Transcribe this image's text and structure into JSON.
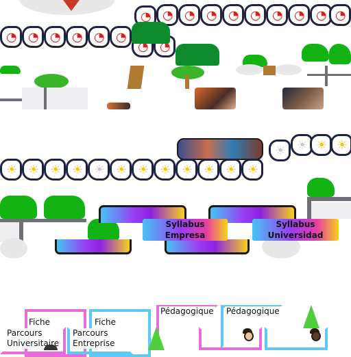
{
  "colors": {
    "red_mark": "#e21b1b",
    "bulb_on": "#f2c318",
    "bulb_off": "#c9c9c9",
    "grass": "#12b312",
    "pink_bracket": "#e86bdc",
    "blue_bracket": "#5fc9f3"
  },
  "icons": {
    "head_red": "head-target-icon",
    "head_bulb": "head-lightbulb-icon",
    "tree": "tree-icon",
    "bush": "bush-icon",
    "avatar": "player-avatar-icon"
  },
  "panels": {
    "syllabus_empresa": {
      "line1": "Syllabus",
      "line2": "Empresa"
    },
    "syllabus_universidad": {
      "line1": "Syllabus",
      "line2": "Universidad"
    }
  },
  "brackets": {
    "fiche_1": "Fiche",
    "fiche_2": "Fiche",
    "parcours_universitaire": {
      "line1": "Parcours",
      "line2": "Universitaire"
    },
    "parcours_entreprise": {
      "line1": "Parcours",
      "line2": "Entreprise"
    },
    "pedagogique_1": "Pédagogique",
    "pedagogique_2": "Pédagogique"
  }
}
